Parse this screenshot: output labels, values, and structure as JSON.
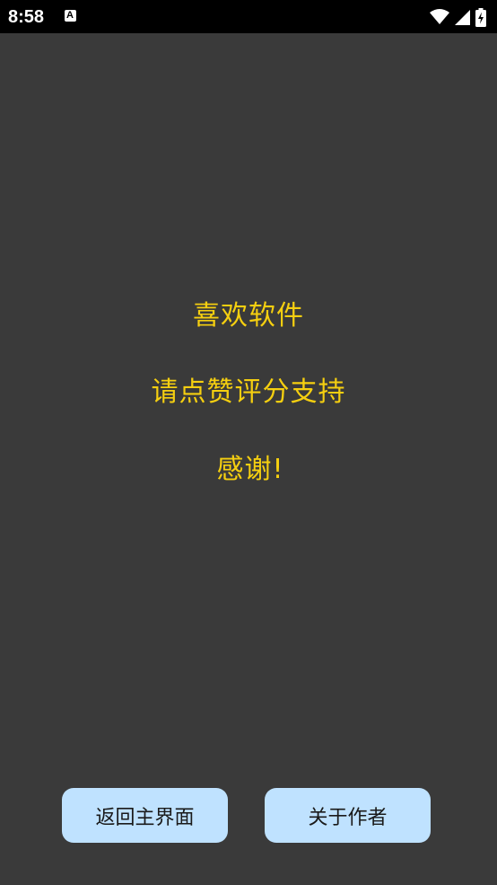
{
  "status_bar": {
    "time": "8:58",
    "notification_glyph": "A",
    "icons": [
      "wifi-icon",
      "cellular-signal-icon",
      "battery-charging-icon"
    ]
  },
  "message": {
    "line1": "喜欢软件",
    "line2": "请点赞评分支持",
    "line3": "感谢!"
  },
  "buttons": {
    "home_label": "返回主界面",
    "about_label": "关于作者"
  },
  "colors": {
    "background": "#3a3a3a",
    "message_text": "#f5cf10",
    "button_bg": "#bfe2ff"
  }
}
